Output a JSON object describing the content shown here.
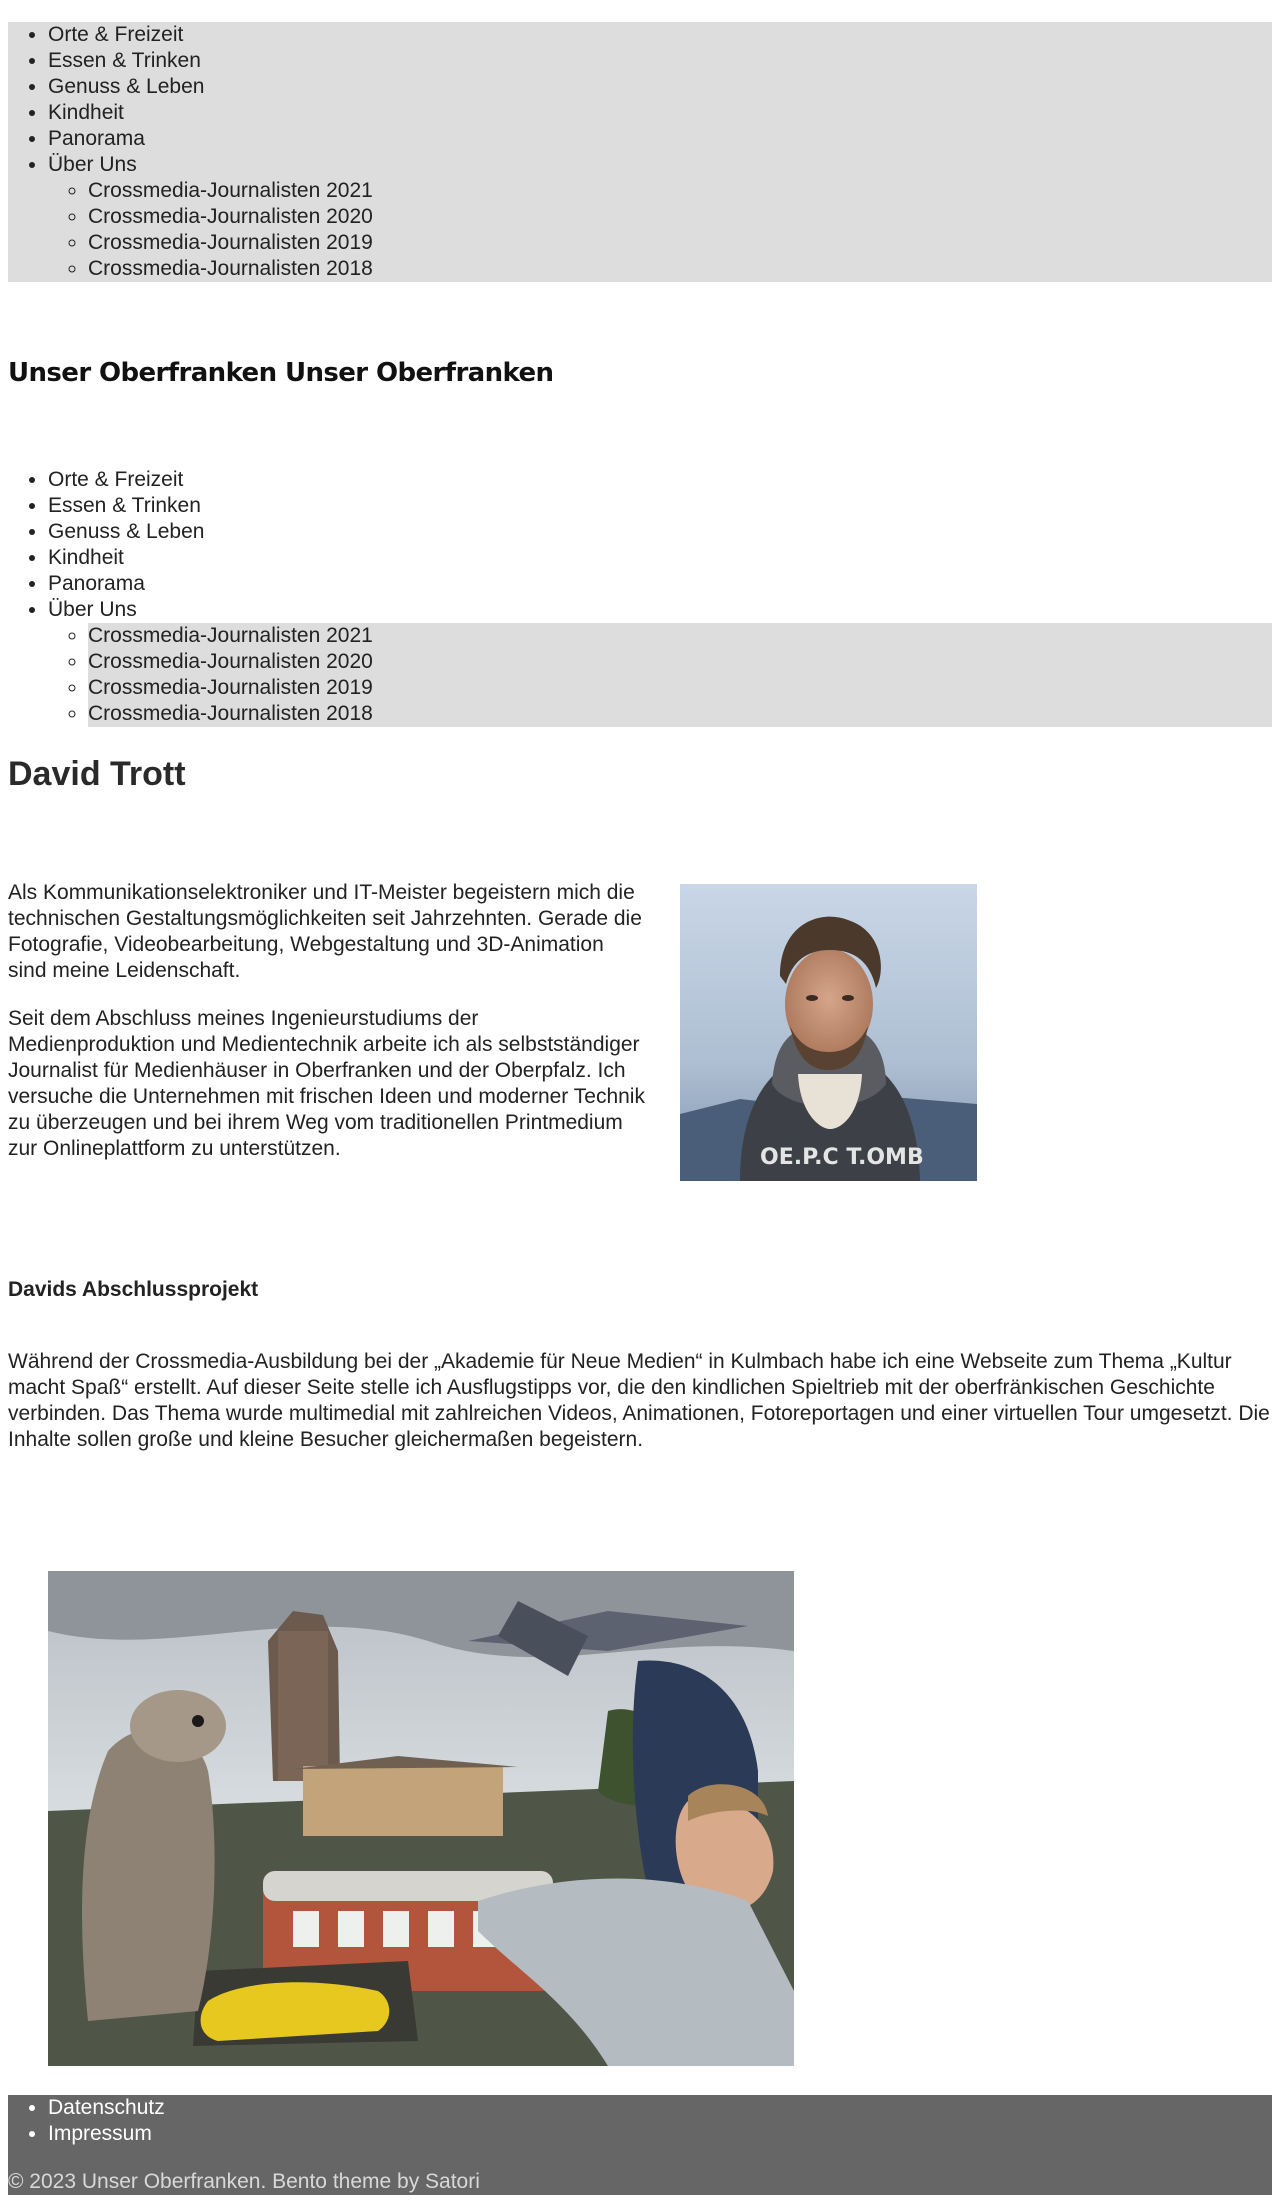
{
  "nav": {
    "items": [
      {
        "label": "Orte & Freizeit"
      },
      {
        "label": "Essen & Trinken"
      },
      {
        "label": "Genuss & Leben"
      },
      {
        "label": "Kindheit"
      },
      {
        "label": "Panorama"
      },
      {
        "label": "Über Uns"
      }
    ],
    "subitems": [
      {
        "label": "Crossmedia-Journalisten 2021"
      },
      {
        "label": "Crossmedia-Journalisten 2020"
      },
      {
        "label": "Crossmedia-Journalisten 2019"
      },
      {
        "label": "Crossmedia-Journalisten 2018"
      }
    ]
  },
  "site": {
    "logo_text": "Unser Oberfranken Unser Oberfranken"
  },
  "article": {
    "title": "David Trott",
    "bio": [
      "Als Kommunikationselektroniker und IT-Meister begeistern mich die technischen Gestaltungsmöglichkeiten seit Jahrzehnten. Gerade die Fotografie, Videobearbeitung, Webgestaltung und 3D-Animation sind meine Leidenschaft.",
      "Seit dem Abschluss meines Ingenieurstudiums der Medienproduktion und Medientechnik arbeite ich als selbstständiger Journalist für Medienhäuser in Oberfranken und der Oberpfalz. Ich versuche die Unternehmen mit frischen Ideen und moderner Technik zu überzeugen und bei ihrem Weg vom traditionellen Printmedium zur Onlineplattform zu unterstützen."
    ],
    "portrait_image": "photo-portrait-man-hoodie",
    "project_heading": "Davids Abschlussprojekt",
    "project_text": "Während der Crossmedia-Ausbildung bei der „Akademie für Neue Medien“ in Kulmbach habe ich eine Webseite zum Thema „Kultur macht Spaß“ erstellt. Auf dieser Seite stelle ich Ausflugstipps vor, die den kindlichen Spieltrieb mit der oberfränkischen Geschichte verbinden. Das Thema wurde multimedial mit zahlreichen Videos, Animationen, Fotoreportagen und einer virtuellen Tour umgesetzt. Die Inhalte sollen große und kleine Besucher gleichermaßen begeistern.",
    "collage_image": "photo-collage-meerkat-railway-spaceship-children"
  },
  "footer": {
    "links": [
      {
        "label": "Datenschutz"
      },
      {
        "label": "Impressum"
      }
    ],
    "copyright": "© 2023 Unser Oberfranken. Bento theme by Satori"
  },
  "colors": {
    "nav_bg": "#dddddd",
    "footer_bg": "#666666",
    "text": "#222222"
  }
}
